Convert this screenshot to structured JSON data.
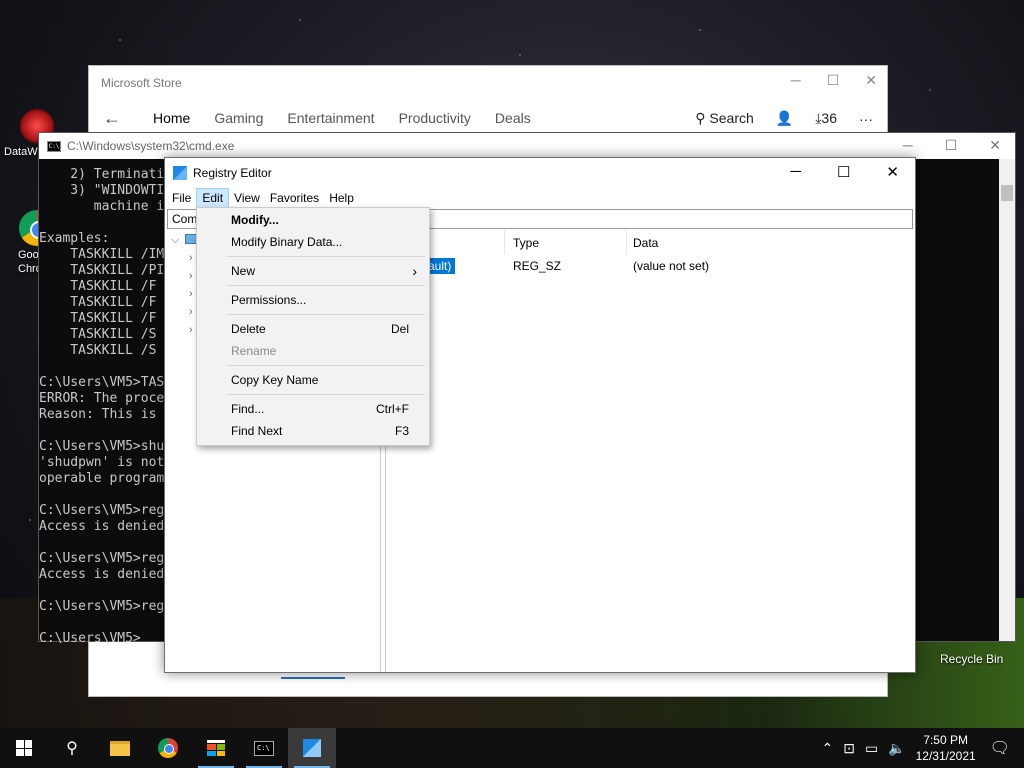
{
  "desktop": {
    "icons": [
      {
        "label": "DataW"
      },
      {
        "label": "Goo\nChro"
      }
    ],
    "recycle_bin": "Recycle Bin"
  },
  "store": {
    "title": "Microsoft Store",
    "nav": [
      "Home",
      "Gaming",
      "Entertainment",
      "Productivity",
      "Deals"
    ],
    "search_label": "Search",
    "downloads_count": "36",
    "more": "···"
  },
  "cmd": {
    "title": "C:\\Windows\\system32\\cmd.exe",
    "lines": [
      "    2) Terminati",
      "    3) \"WINDOWTI",
      "       machine i",
      "",
      "Examples:",
      "    TASKKILL /IM",
      "    TASKKILL /PI",
      "    TASKKILL /F ",
      "    TASKKILL /F ",
      "    TASKKILL /F ",
      "    TASKKILL /S ",
      "    TASKKILL /S ",
      "",
      "C:\\Users\\VM5>TAS",
      "ERROR: The proce",
      "Reason: This is ",
      "",
      "C:\\Users\\VM5>shu",
      "'shudpwn' is not",
      "operable program",
      "",
      "C:\\Users\\VM5>reg",
      "Access is denied",
      "",
      "C:\\Users\\VM5>reg",
      "Access is denied",
      "",
      "C:\\Users\\VM5>reg",
      "",
      "C:\\Users\\VM5>"
    ]
  },
  "regedit": {
    "title": "Registry Editor",
    "menu": [
      "File",
      "Edit",
      "View",
      "Favorites",
      "Help"
    ],
    "address": "Com",
    "columns": {
      "type": "Type",
      "data": "Data"
    },
    "row": {
      "name": "ault)",
      "type": "REG_SZ",
      "data": "(value not set)"
    }
  },
  "edit_menu": {
    "items": [
      {
        "label": "Modify...",
        "shortcut": ""
      },
      {
        "label": "Modify Binary Data...",
        "shortcut": ""
      },
      {
        "label": "New",
        "shortcut": "›"
      },
      {
        "label": "Permissions...",
        "shortcut": ""
      },
      {
        "label": "Delete",
        "shortcut": "Del"
      },
      {
        "label": "Rename",
        "shortcut": ""
      },
      {
        "label": "Copy Key Name",
        "shortcut": ""
      },
      {
        "label": "Find...",
        "shortcut": "Ctrl+F"
      },
      {
        "label": "Find Next",
        "shortcut": "F3"
      }
    ]
  },
  "taskbar": {
    "time": "7:50 PM",
    "date": "12/31/2021"
  }
}
